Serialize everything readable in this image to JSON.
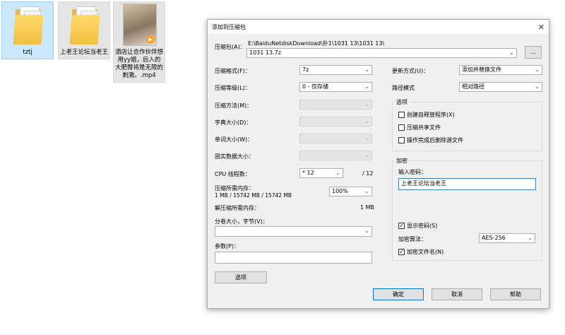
{
  "desktop": {
    "icons": [
      {
        "label": "tztj"
      },
      {
        "label": "上老王论坛当老王"
      },
      {
        "label": "酒店让合作伙伴想用yy姐，后入的大肥臀将是无限的刺激。.mp4"
      }
    ]
  },
  "dialog": {
    "title": "添加到压缩包",
    "archive_label": "压缩包(A)：",
    "archive_path": "E:\\BaiduNetdiskDownload\\扑1\\1031 13\\1031 13\\",
    "archive_name": "1031 13.7z",
    "browse_label": "...",
    "format_label": "压缩格式(F)：",
    "format_value": "7z",
    "level_label": "压缩等级(L)：",
    "level_value": "0 - 仅存储",
    "method_label": "压缩方法(M)：",
    "dict_label": "字典大小(D)：",
    "word_label": "单词大小(W)：",
    "solid_label": "固实数据大小：",
    "threads_label": "CPU 线程数：",
    "threads_value": "* 12",
    "threads_total": "/ 12",
    "mem_comp_label": "压缩所需内存：",
    "mem_comp_detail": "1 MB / 15742 MB / 15742 MB",
    "mem_percent": "100%",
    "mem_decomp_label": "解压缩所需内存：",
    "mem_decomp_value": "1 MB",
    "volume_label": "分卷大小，字节(V)：",
    "volume_value": "",
    "params_label": "参数(P)：",
    "params_value": "",
    "options_button": "选项",
    "update_label": "更新方式(U)：",
    "update_value": "添加并替换文件",
    "path_label": "路径模式",
    "path_value": "相对路径",
    "options_group": "选项",
    "opt_sfx": "创建自释放程序(X)",
    "opt_shared": "压缩共享文件",
    "opt_delete": "操作完成后删除源文件",
    "encrypt_group": "加密",
    "password_label": "输入密码：",
    "password_value": "上老王论坛当老王",
    "show_password": "显示密码(S)",
    "encrypt_method_label": "加密算法：",
    "encrypt_method_value": "AES-256",
    "encrypt_names": "加密文件名(N)",
    "ok": "确定",
    "cancel": "取消",
    "help": "帮助",
    "close_glyph": "✕",
    "dropdown_glyph": "⌄",
    "check_glyph": "✓"
  }
}
